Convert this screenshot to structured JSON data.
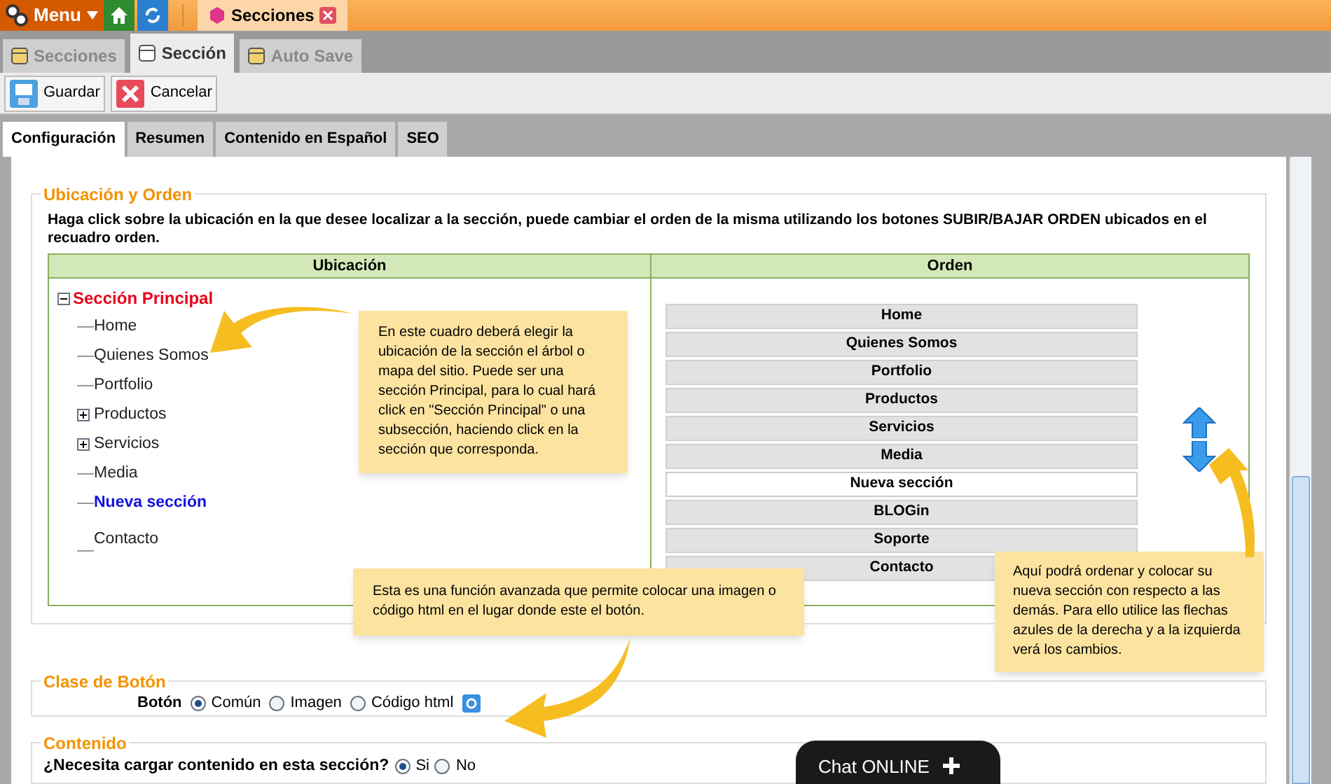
{
  "top_bar": {
    "menu": "Menu",
    "doc_tab": "Secciones"
  },
  "tabs": [
    {
      "label": "Secciones",
      "selected": false
    },
    {
      "label": "Sección",
      "selected": true
    },
    {
      "label": "Auto Save",
      "selected": false
    }
  ],
  "toolbar": [
    {
      "kind": "save",
      "label": "Guardar"
    },
    {
      "kind": "cancel",
      "label": "Cancelar"
    }
  ],
  "subtabs": [
    {
      "label": "Configuración",
      "selected": true
    },
    {
      "label": "Resumen",
      "selected": false
    },
    {
      "label": "Contenido en Español",
      "selected": false
    },
    {
      "label": "SEO",
      "selected": false
    }
  ],
  "ubicacion": {
    "legend": "Ubicación y Orden",
    "description": "Haga click sobre la ubicación en la que desee localizar a la sección, puede cambiar el orden de la misma utilizando los botones SUBIR/BAJAR ORDEN ubicados en el recuadro orden.",
    "columns": [
      "Ubicación",
      "Orden"
    ],
    "tree": {
      "label": "Sección Principal",
      "expanded": true,
      "children": [
        {
          "label": "Home",
          "selected": false
        },
        {
          "label": "Quienes Somos",
          "selected": false
        },
        {
          "label": "Portfolio",
          "selected": false
        },
        {
          "label": "Productos",
          "selected": false,
          "expanded": false
        },
        {
          "label": "Servicios",
          "selected": false,
          "expanded": false
        },
        {
          "label": "Media",
          "selected": false
        },
        {
          "label": "Nueva sección",
          "selected": true
        },
        {
          "label": "Contacto",
          "selected": false
        }
      ]
    },
    "order": [
      {
        "label": "Home",
        "selected": false
      },
      {
        "label": "Quienes Somos",
        "selected": false
      },
      {
        "label": "Portfolio",
        "selected": false
      },
      {
        "label": "Productos",
        "selected": false
      },
      {
        "label": "Servicios",
        "selected": false
      },
      {
        "label": "Media",
        "selected": false
      },
      {
        "label": "Nueva sección",
        "selected": true
      },
      {
        "label": "BLOGin",
        "selected": false
      },
      {
        "label": "Soporte",
        "selected": false
      },
      {
        "label": "Contacto",
        "selected": false
      }
    ]
  },
  "callouts": [
    "En este cuadro deberá elegir la ubicación de la sección el árbol o mapa del sitio. Puede ser una sección Principal, para lo cual hará click en \"Sección Principal\" o una subsección, haciendo click en la sección que corresponda.",
    "Esta es una función avanzada que permite colocar una imagen o código html en el lugar donde este el botón.",
    "Aquí podrá ordenar y colocar su nueva sección con respecto a las demás. Para ello utilice las flechas azules de la derecha y a la izquierda verá los cambios."
  ],
  "clase_boton": {
    "legend": "Clase de Botón",
    "label": "Botón",
    "options": [
      {
        "label": "Común",
        "selected": true
      },
      {
        "label": "Imagen",
        "selected": false
      },
      {
        "label": "Código html",
        "selected": false
      }
    ]
  },
  "contenido": {
    "legend": "Contenido",
    "question": "¿Necesita cargar contenido en esta sección?",
    "options": [
      {
        "label": "Si",
        "selected": true
      },
      {
        "label": "No",
        "selected": false
      }
    ]
  },
  "chat": {
    "label": "Chat ONLINE"
  }
}
